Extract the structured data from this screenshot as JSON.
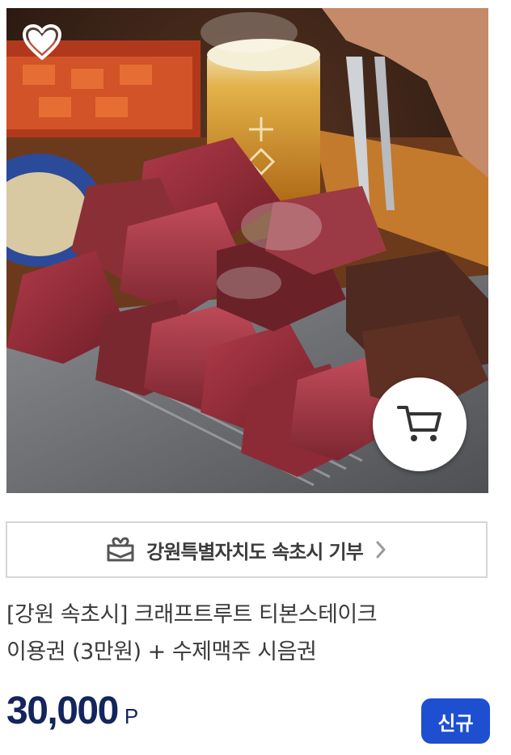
{
  "product": {
    "image_alt": "티본스테이크 사진",
    "favorite_icon": "heart-icon",
    "cart_icon": "shopping-cart-icon",
    "donation_banner": {
      "icon": "gift-box-icon",
      "label": "강원특별자치도 속초시 기부",
      "arrow_icon": "chevron-right-icon"
    },
    "title_lines": [
      "[강원 속초시] 크래프트루트 티본스테이크",
      "이용권 (3만원) + 수제맥주 시음권"
    ],
    "price": {
      "amount": "30,000",
      "unit": "P"
    },
    "badge": "신규",
    "colors": {
      "price": "#14245c",
      "badge_bg": "#1f4fd1",
      "border": "#d6d6d6"
    }
  }
}
